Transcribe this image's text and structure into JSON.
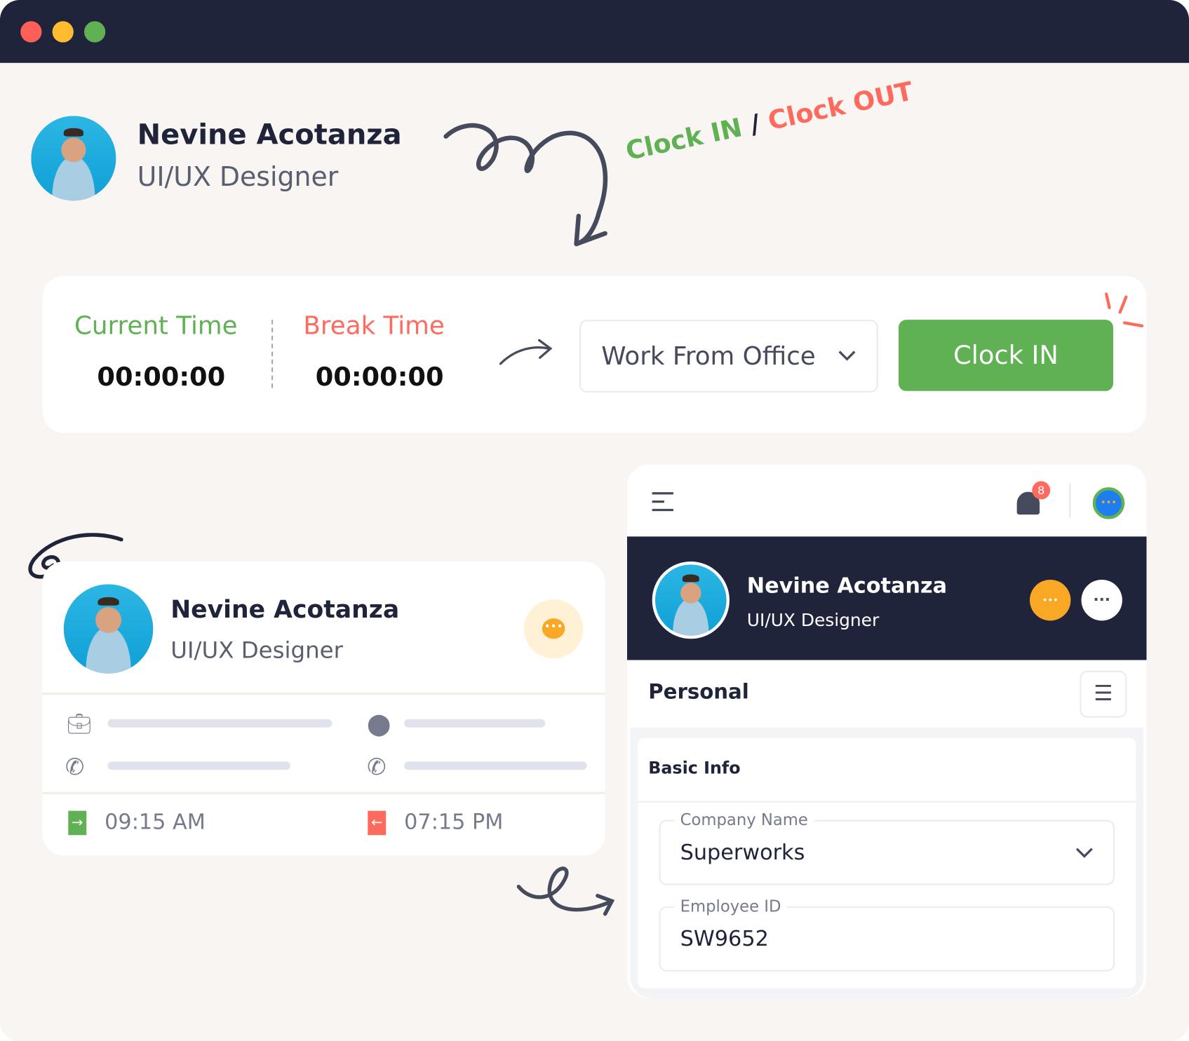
{
  "window": {
    "controls": [
      "close",
      "minimize",
      "maximize"
    ],
    "colors": {
      "close": "#fe5f57",
      "minimize": "#febc2e",
      "maximize": "#5fb153"
    }
  },
  "header_profile": {
    "name": "Nevine Acotanza",
    "role": "UI/UX Designer"
  },
  "annotation": {
    "clock_in": "Clock IN",
    "separator": "/",
    "clock_out": "Clock OUT",
    "green": "#5fb153",
    "red": "#fe6a5e"
  },
  "clock_panel": {
    "current_time_label": "Current Time",
    "current_time": "00:00:00",
    "break_time_label": "Break Time",
    "break_time": "00:00:00",
    "work_mode": "Work From Office",
    "clock_in_button": "Clock IN"
  },
  "employee_card": {
    "name": "Nevine Acotanza",
    "role": "UI/UX Designer",
    "clock_in_time": "09:15 AM",
    "clock_out_time": "07:15 PM"
  },
  "profile_panel": {
    "notification_count": "8",
    "name": "Nevine Acotanza",
    "role": "UI/UX Designer",
    "section_title": "Personal",
    "subsection_title": "Basic Info",
    "company_label": "Company Name",
    "company_value": "Superworks",
    "employee_id_label": "Employee ID",
    "employee_id_value": "SW9652"
  }
}
